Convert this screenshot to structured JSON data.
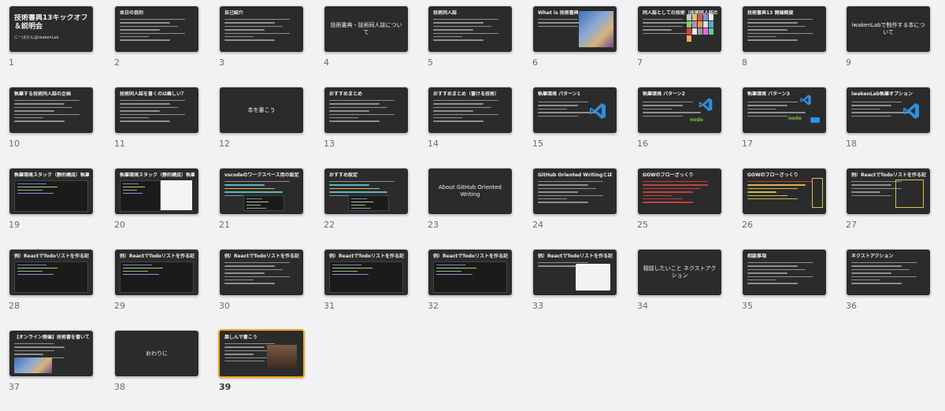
{
  "slides": [
    {
      "n": "1",
      "title": "技術書典13キックオフ＆説明会",
      "sub": "にーばかん@iwakenLab",
      "style": "cover"
    },
    {
      "n": "2",
      "title": "本日の目的",
      "style": "text"
    },
    {
      "n": "3",
      "title": "自己紹介",
      "style": "text"
    },
    {
      "n": "4",
      "title": "技術書典・技術同人誌について",
      "style": "center"
    },
    {
      "n": "5",
      "title": "技術同人誌",
      "style": "text"
    },
    {
      "n": "6",
      "title": "What is 技術書典",
      "style": "collage"
    },
    {
      "n": "7",
      "title": "同人誌としての技術（技術同人誌の技術）",
      "style": "books"
    },
    {
      "n": "8",
      "title": "技術書典13 開催概要",
      "style": "text"
    },
    {
      "n": "9",
      "title": "iwakenLabで制作する本について",
      "style": "center"
    },
    {
      "n": "10",
      "title": "執筆する技術同人誌の企画",
      "style": "text"
    },
    {
      "n": "11",
      "title": "技術同人誌を書くのは難しい？",
      "style": "text"
    },
    {
      "n": "12",
      "title": "本を書こう",
      "style": "center"
    },
    {
      "n": "13",
      "title": "おすすめまとめ",
      "style": "text"
    },
    {
      "n": "14",
      "title": "おすすめまとめ（書ける技術）",
      "style": "text"
    },
    {
      "n": "15",
      "title": "執筆環境 パターン1",
      "style": "vscode"
    },
    {
      "n": "16",
      "title": "執筆環境 パターン2",
      "style": "vscode-node"
    },
    {
      "n": "17",
      "title": "執筆環境 パターン3",
      "style": "vscode-docker"
    },
    {
      "n": "18",
      "title": "iwakenLab執筆オプション",
      "style": "vscode"
    },
    {
      "n": "19",
      "title": "執筆環境スタック（静的構成）執筆環境",
      "style": "screenshot"
    },
    {
      "n": "20",
      "title": "執筆環境スタック（静的構成）執筆環境Live Mode",
      "style": "screenshot-white"
    },
    {
      "n": "21",
      "title": "vscodeのワークスペース用の設定",
      "style": "code"
    },
    {
      "n": "22",
      "title": "おすすめ設定",
      "style": "code"
    },
    {
      "n": "23",
      "title": "About GitHub Oriented Writing",
      "style": "center"
    },
    {
      "n": "24",
      "title": "GitHub Oriented Writingとは？GOWとは",
      "style": "text"
    },
    {
      "n": "25",
      "title": "GOWのフローざっくり",
      "style": "flow"
    },
    {
      "n": "26",
      "title": "GOWのフローざっくり",
      "style": "flow-box"
    },
    {
      "n": "27",
      "title": "例）ReactでTodoリストを作る記事",
      "style": "text-box"
    },
    {
      "n": "28",
      "title": "例）ReactでTodoリストを作る記事",
      "style": "screenshot"
    },
    {
      "n": "29",
      "title": "例）ReactでTodoリストを作る記事",
      "style": "screenshot"
    },
    {
      "n": "30",
      "title": "例）ReactでTodoリストを作る記事",
      "style": "text"
    },
    {
      "n": "31",
      "title": "例）ReactでTodoリストを作る記事",
      "style": "screenshot"
    },
    {
      "n": "32",
      "title": "例）ReactでTodoリストを作る記事",
      "style": "screenshot"
    },
    {
      "n": "33",
      "title": "例）ReactでTodoリストを作る記事",
      "style": "illus"
    },
    {
      "n": "34",
      "title": "相談したいこと ネクストアクション",
      "style": "center"
    },
    {
      "n": "35",
      "title": "相談事項",
      "style": "text"
    },
    {
      "n": "36",
      "title": "ネクストアクション",
      "style": "text"
    },
    {
      "n": "37",
      "title": "【オンライン開催】技術書を書いてみよう！",
      "style": "collage2"
    },
    {
      "n": "38",
      "title": "おわりに",
      "style": "center"
    },
    {
      "n": "39",
      "title": "楽しんで書こう",
      "style": "photo",
      "selected": true
    }
  ]
}
